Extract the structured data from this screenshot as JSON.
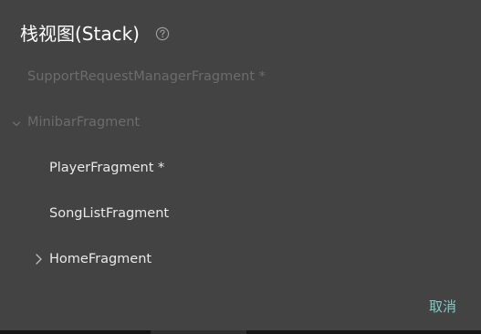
{
  "dialog": {
    "title": "栈视图(Stack)",
    "help_icon": "help-circle-icon",
    "cancel_label": "取消"
  },
  "tree": [
    {
      "label": "SupportRequestManagerFragment *",
      "depth": 0,
      "state": "inactive",
      "toggle": "none"
    },
    {
      "label": "MinibarFragment",
      "depth": 0,
      "state": "inactive",
      "toggle": "chevron-down-icon"
    },
    {
      "label": "PlayerFragment *",
      "depth": 1,
      "state": "active",
      "toggle": "none"
    },
    {
      "label": "SongListFragment",
      "depth": 1,
      "state": "active",
      "toggle": "none"
    },
    {
      "label": "HomeFragment",
      "depth": 1,
      "state": "active",
      "toggle": "chevron-right-icon"
    }
  ],
  "colors": {
    "dialog_background": "#434343",
    "title_text": "#ffffff",
    "inactive_text": "#6c6c6c",
    "active_text": "#e9e9e9",
    "accent": "#80cbc4"
  }
}
